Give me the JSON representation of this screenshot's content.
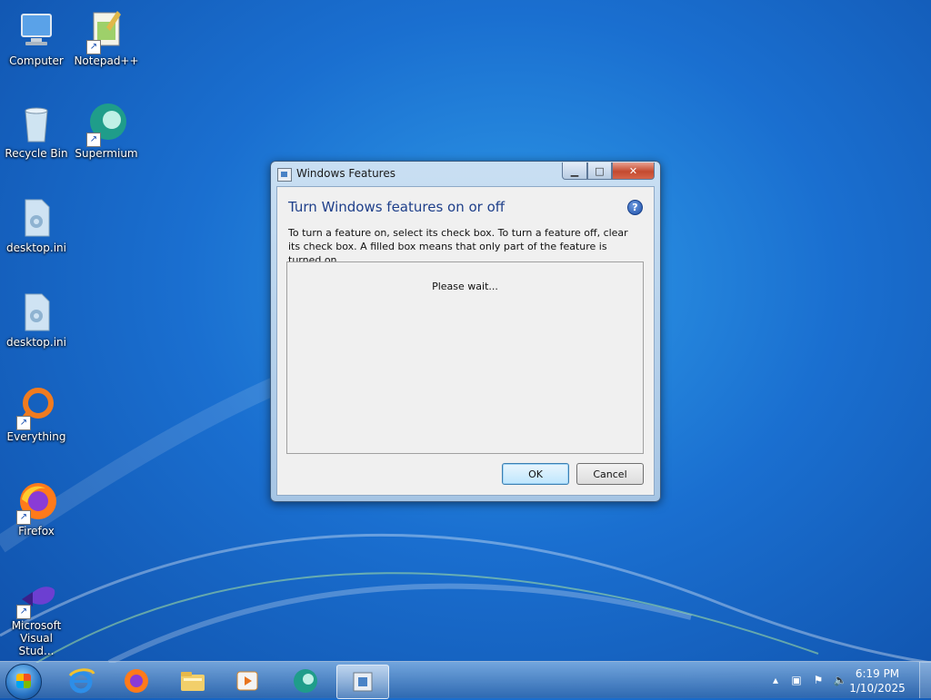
{
  "desktop": {
    "icons": [
      {
        "label": "Computer",
        "icon": "computer-icon"
      },
      {
        "label": "Notepad++",
        "icon": "notepadpp-icon"
      },
      {
        "label": "Recycle Bin",
        "icon": "recycle-bin-icon"
      },
      {
        "label": "Supermium",
        "icon": "supermium-icon"
      },
      {
        "label": "desktop.ini",
        "icon": "settings-file-icon"
      },
      {
        "label": "desktop.ini",
        "icon": "settings-file-icon"
      },
      {
        "label": "Everything",
        "icon": "everything-icon"
      },
      {
        "label": "Firefox",
        "icon": "firefox-icon"
      },
      {
        "label": "Microsoft Visual Stud...",
        "icon": "visual-studio-icon"
      }
    ]
  },
  "window": {
    "title": "Windows Features",
    "heading": "Turn Windows features on or off",
    "description": "To turn a feature on, select its check box. To turn a feature off, clear its check box. A filled box means that only part of the feature is turned on.",
    "status": "Please wait...",
    "ok_label": "OK",
    "cancel_label": "Cancel",
    "help_glyph": "?"
  },
  "taskbar": {
    "pinned": [
      "internet-explorer-icon",
      "firefox-icon",
      "file-explorer-icon",
      "media-player-icon",
      "supermium-icon",
      "windows-features-icon"
    ],
    "tray": {
      "time": "6:19 PM",
      "date": "1/10/2025"
    }
  },
  "colors": {
    "heading": "#1e3f8a",
    "close_button": "#c44a2f",
    "desktop": "#1a6fd0"
  }
}
